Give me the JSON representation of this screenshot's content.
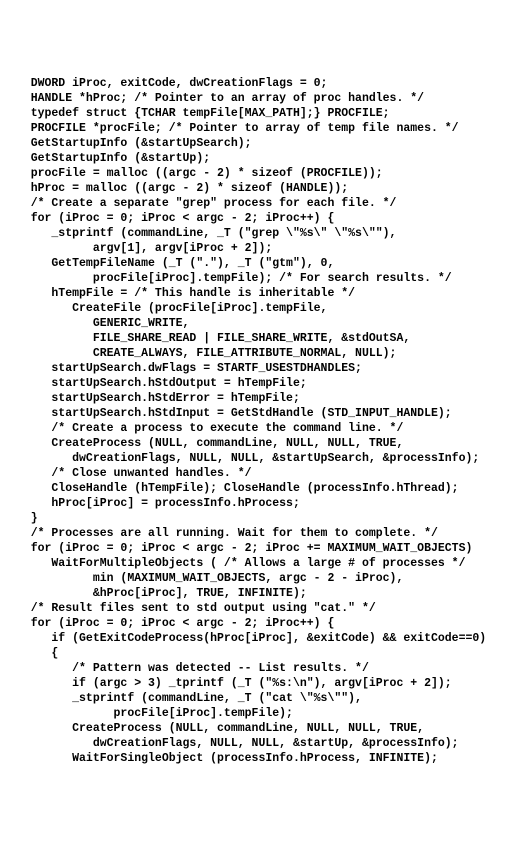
{
  "lines": [
    "   DWORD iProc, exitCode, dwCreationFlags = 0;",
    "   HANDLE *hProc; /* Pointer to an array of proc handles. */",
    "   typedef struct {TCHAR tempFile[MAX_PATH];} PROCFILE;",
    "   PROCFILE *procFile; /* Pointer to array of temp file names. */",
    "",
    "   GetStartupInfo (&startUpSearch);",
    "   GetStartupInfo (&startUp);",
    "   procFile = malloc ((argc - 2) * sizeof (PROCFILE));",
    "   hProc = malloc ((argc - 2) * sizeof (HANDLE));",
    "",
    "   /* Create a separate \"grep\" process for each file. */",
    "   for (iProc = 0; iProc < argc - 2; iProc++) {",
    "      _stprintf (commandLine, _T (\"grep \\\"%s\\\" \\\"%s\\\"\"),",
    "            argv[1], argv[iProc + 2]);",
    "      GetTempFileName (_T (\".\"), _T (\"gtm\"), 0,",
    "            procFile[iProc].tempFile); /* For search results. */",
    "      hTempFile = /* This handle is inheritable */",
    "         CreateFile (procFile[iProc].tempFile,",
    "            GENERIC_WRITE,",
    "            FILE_SHARE_READ | FILE_SHARE_WRITE, &stdOutSA,",
    "            CREATE_ALWAYS, FILE_ATTRIBUTE_NORMAL, NULL);",
    "      startUpSearch.dwFlags = STARTF_USESTDHANDLES;",
    "      startUpSearch.hStdOutput = hTempFile;",
    "      startUpSearch.hStdError = hTempFile;",
    "      startUpSearch.hStdInput = GetStdHandle (STD_INPUT_HANDLE);",
    "",
    "      /* Create a process to execute the command line. */",
    "      CreateProcess (NULL, commandLine, NULL, NULL, TRUE,",
    "         dwCreationFlags, NULL, NULL, &startUpSearch, &processInfo);",
    "      /* Close unwanted handles. */",
    "      CloseHandle (hTempFile); CloseHandle (processInfo.hThread);",
    "      hProc[iProc] = processInfo.hProcess;",
    "   }",
    "",
    "   /* Processes are all running. Wait for them to complete. */",
    "   for (iProc = 0; iProc < argc - 2; iProc += MAXIMUM_WAIT_OBJECTS)",
    "      WaitForMultipleObjects ( /* Allows a large # of processes */",
    "            min (MAXIMUM_WAIT_OBJECTS, argc - 2 - iProc),",
    "            &hProc[iProc], TRUE, INFINITE);",
    "   /* Result files sent to std output using \"cat.\" */",
    "   for (iProc = 0; iProc < argc - 2; iProc++) {",
    "      if (GetExitCodeProcess(hProc[iProc], &exitCode) && exitCode==0)",
    "      {",
    "         /* Pattern was detected -- List results. */",
    "         if (argc > 3) _tprintf (_T (\"%s:\\n\"), argv[iProc + 2]);",
    "         _stprintf (commandLine, _T (\"cat \\\"%s\\\"\"),",
    "               procFile[iProc].tempFile);",
    "         CreateProcess (NULL, commandLine, NULL, NULL, TRUE,",
    "            dwCreationFlags, NULL, NULL, &startUp, &processInfo);",
    "         WaitForSingleObject (processInfo.hProcess, INFINITE);"
  ]
}
